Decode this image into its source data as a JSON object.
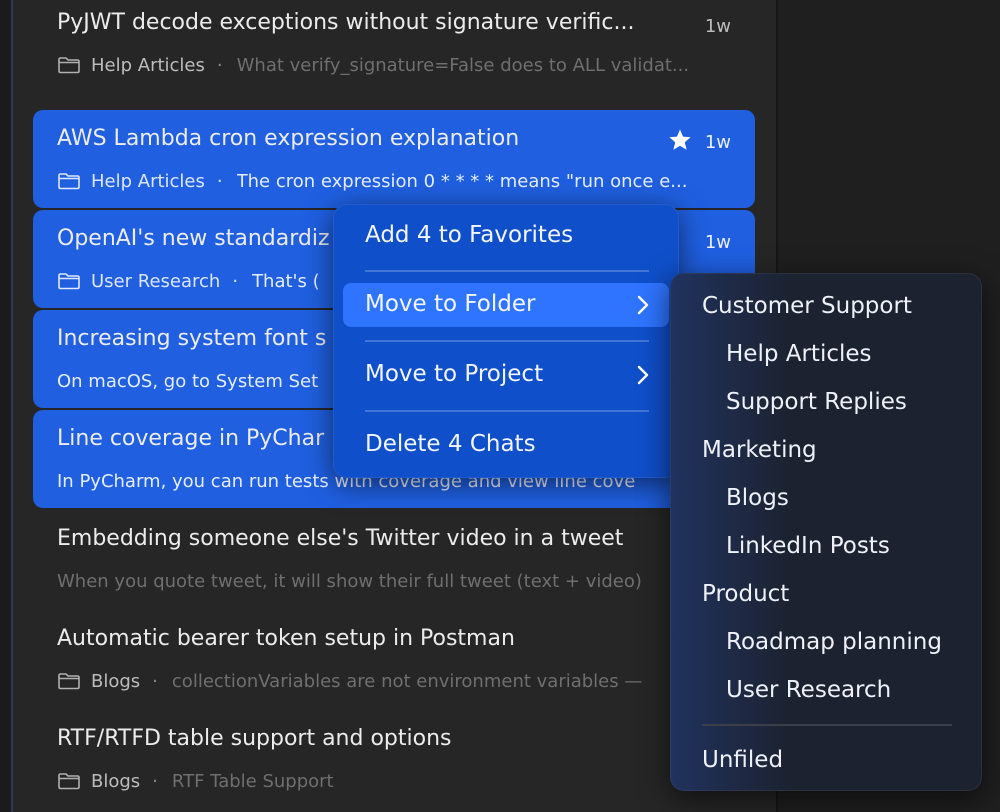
{
  "chats": [
    {
      "title": "PyJWT decode exceptions without signature verific...",
      "time": "1w",
      "folder": "Help Articles",
      "preview": "What verify_signature=False does to ALL validat...",
      "selected": false,
      "starred": false
    },
    {
      "title": "AWS Lambda cron expression explanation",
      "time": "1w",
      "folder": "Help Articles",
      "preview": "The cron expression 0 * * * * means \"run once e...",
      "selected": true,
      "starred": true
    },
    {
      "title": "OpenAI's new standardiz",
      "time": "1w",
      "folder": "User Research",
      "preview": "That's (",
      "selected": true,
      "starred": false
    },
    {
      "title": "Increasing system font s",
      "time": "",
      "folder": "",
      "preview": "On macOS, go to System Set",
      "selected": true,
      "starred": false
    },
    {
      "title": "Line coverage in PyChar",
      "time": "",
      "folder": "",
      "preview": "In PyCharm, you can run tests with coverage and view line cove",
      "selected": true,
      "starred": false
    },
    {
      "title": "Embedding someone else's Twitter video in a tweet",
      "time": "",
      "folder": "",
      "preview": "When you quote tweet, it will show their full tweet (text + video)",
      "selected": false,
      "starred": false
    },
    {
      "title": "Automatic bearer token setup in Postman",
      "time": "",
      "folder": "Blogs",
      "preview": "collectionVariables are not environment variables —",
      "selected": false,
      "starred": false
    },
    {
      "title": "RTF/RTFD table support and options",
      "time": "",
      "folder": "Blogs",
      "preview": "RTF Table Support",
      "selected": false,
      "starred": false
    }
  ],
  "context_menu": {
    "items": [
      {
        "label": "Add 4 to Favorites",
        "has_submenu": false
      },
      {
        "label": "Move to Folder",
        "has_submenu": true,
        "highlighted": true
      },
      {
        "label": "Move to Project",
        "has_submenu": true
      },
      {
        "label": "Delete 4 Chats",
        "has_submenu": false
      }
    ]
  },
  "folder_submenu": {
    "items": [
      {
        "label": "Customer Support",
        "level": 0
      },
      {
        "label": "Help Articles",
        "level": 1
      },
      {
        "label": "Support Replies",
        "level": 1
      },
      {
        "label": "Marketing",
        "level": 0
      },
      {
        "label": "Blogs",
        "level": 1
      },
      {
        "label": "LinkedIn Posts",
        "level": 1
      },
      {
        "label": "Product",
        "level": 0
      },
      {
        "label": "Roadmap planning",
        "level": 1
      },
      {
        "label": "User Research",
        "level": 1
      }
    ],
    "unfiled_label": "Unfiled"
  },
  "icons": {
    "folder": "folder-icon",
    "star": "star-icon",
    "chevron": "chevron-right-icon"
  },
  "colors": {
    "selection": "#1f5fe0",
    "menu_bg": "#0f4fc9",
    "menu_highlight": "#2e74ff",
    "submenu_bg": "#1c2230"
  }
}
